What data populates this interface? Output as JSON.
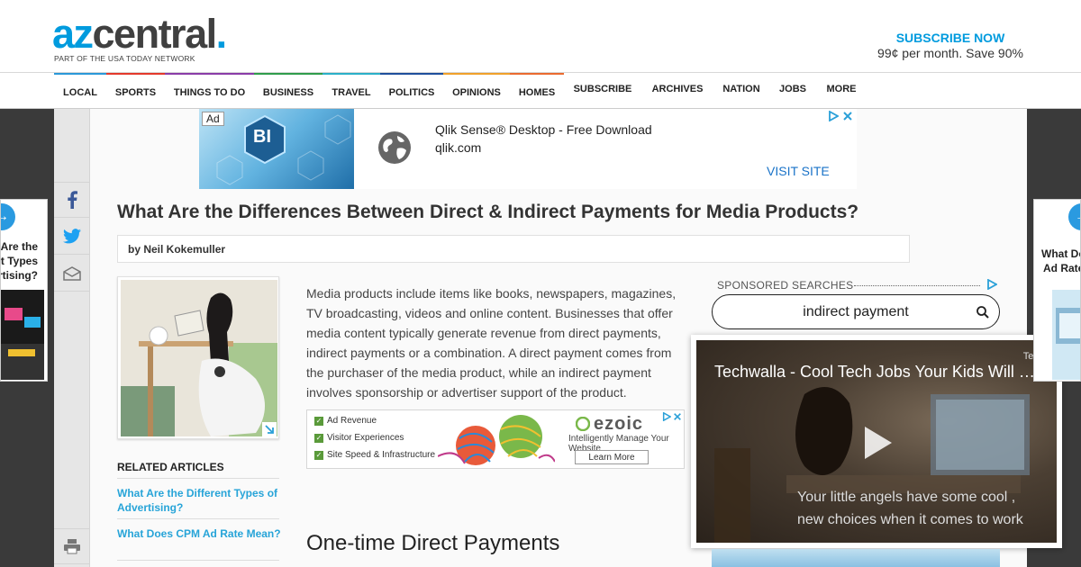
{
  "header": {
    "logo_az": "az",
    "logo_central": "central",
    "logo_dot": ".",
    "logo_tagline": "PART OF THE USA TODAY NETWORK",
    "subscribe_title": "SUBSCRIBE NOW",
    "subscribe_price": "99¢ per month. Save 90%"
  },
  "nav": {
    "items": [
      {
        "label": "LOCAL",
        "color": "#2a98d8"
      },
      {
        "label": "SPORTS",
        "color": "#e4392b"
      },
      {
        "label": "THINGS TO DO",
        "color": "#8a3ca8"
      },
      {
        "label": "BUSINESS",
        "color": "#2f9d4b"
      },
      {
        "label": "TRAVEL",
        "color": "#2ab0c8"
      },
      {
        "label": "POLITICS",
        "color": "#1e4f9c"
      },
      {
        "label": "OPINIONS",
        "color": "#f0a12a"
      },
      {
        "label": "HOMES",
        "color": "#ea6b2f"
      },
      {
        "label": "SUBSCRIBE",
        "color": ""
      },
      {
        "label": "ARCHIVES",
        "color": ""
      },
      {
        "label": "NATION",
        "color": ""
      },
      {
        "label": "JOBS",
        "color": ""
      },
      {
        "label": "MORE",
        "color": ""
      }
    ]
  },
  "share": {
    "icons": [
      "facebook-icon",
      "twitter-icon",
      "email-icon",
      "print-icon"
    ]
  },
  "top_ad": {
    "tag": "Ad",
    "hex_label": "BI",
    "title": "Qlik Sense® Desktop - Free Download",
    "url": "qlik.com",
    "cta": "VISIT SITE"
  },
  "article": {
    "headline": "What Are the Differences Between Direct & Indirect Payments for Media Products?",
    "byline": "by Neil Kokemuller",
    "body": "Media products include items like books, newspapers, magazines, TV broadcasting, videos and online content. Businesses that offer media content typically generate revenue from direct payments, indirect payments or a combination. A direct payment comes from the purchaser of the media product, while an indirect payment involves sponsorship or advertiser support of the product.",
    "subhead": "One-time Direct Payments"
  },
  "related": {
    "title": "RELATED ARTICLES",
    "links": [
      "What Are the Different Types of Advertising?",
      "What Does CPM Ad Rate Mean?"
    ]
  },
  "ezoic_ad": {
    "items": [
      "Ad Revenue",
      "Visitor Experiences",
      "Site Speed & Infrastructure"
    ],
    "logo": "ezoic",
    "tagline": "Intelligently Manage Your Website",
    "button": "Learn More"
  },
  "sponsored": {
    "label": "SPONSORED SEARCHES",
    "query": "indirect payment"
  },
  "video": {
    "title": "Techwalla - Cool Tech Jobs Your Kids Will Love",
    "brand": "Techwa",
    "caption_line1": "Your little angels have some cool ,",
    "caption_line2": "new choices when it comes to work"
  },
  "float_left": {
    "lines": [
      "Are the",
      "t Types",
      "rtising?"
    ]
  },
  "float_right": {
    "lines": [
      "What Do",
      "Ad Rate"
    ]
  }
}
